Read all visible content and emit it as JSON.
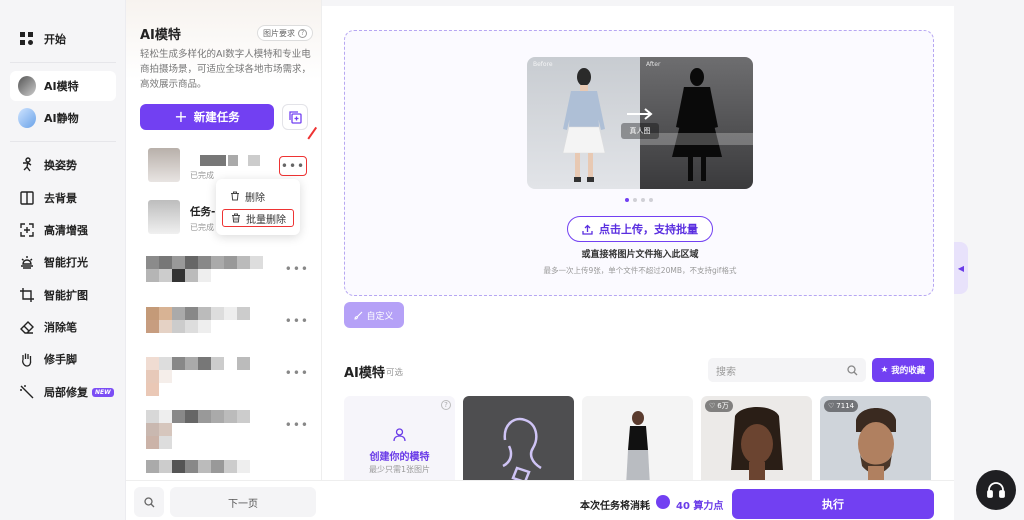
{
  "nav": {
    "items": [
      {
        "label": "开始",
        "icon": "grid-icon"
      },
      {
        "label": "AI模特",
        "icon": "avatar-icon"
      },
      {
        "label": "AI静物",
        "icon": "still-life-icon"
      },
      {
        "label": "换姿势",
        "icon": "pose-icon"
      },
      {
        "label": "去背景",
        "icon": "remove-bg-icon"
      },
      {
        "label": "高清增强",
        "icon": "enhance-icon"
      },
      {
        "label": "智能打光",
        "icon": "light-icon"
      },
      {
        "label": "智能扩图",
        "icon": "crop-expand-icon"
      },
      {
        "label": "消除笔",
        "icon": "eraser-icon"
      },
      {
        "label": "修手脚",
        "icon": "hand-icon"
      },
      {
        "label": "局部修复",
        "icon": "magic-wand-icon",
        "badge": "NEW"
      }
    ]
  },
  "panel": {
    "title": "AI模特",
    "image_requirements": "图片要求",
    "description": "轻松生成多样化的AI数字人模特和专业电商拍摄场景，可适应全球各地市场需求，高效展示商品。",
    "new_task": "新建任务",
    "tasks": [
      {
        "name": "",
        "status": "已完成"
      },
      {
        "name": "任务-",
        "status": "已完成"
      }
    ],
    "menu": {
      "delete": "删除",
      "batch_delete": "批量删除"
    },
    "next_page": "下一页"
  },
  "upload": {
    "before": "Before",
    "after": "After",
    "real_label": "真人图",
    "button": "点击上传，支持批量",
    "drag_hint": "或直接将图片文件拖入此区域",
    "limit_hint": "最多一次上传9张，单个文件不超过20MB，不支持gif格式",
    "custom": "自定义"
  },
  "models": {
    "title": "AI模特",
    "subtitle": "可选",
    "search_placeholder": "搜索",
    "favorites": "我的收藏",
    "create_title": "创建你的模特",
    "create_sub": "最少只需1张图片",
    "likes": [
      "6万",
      "7114"
    ]
  },
  "footer": {
    "cost_label": "本次任务将消耗",
    "cost_value": "40 算力点",
    "run": "执行"
  },
  "colors": {
    "accent": "#7240f2",
    "highlight": "#e33333"
  }
}
